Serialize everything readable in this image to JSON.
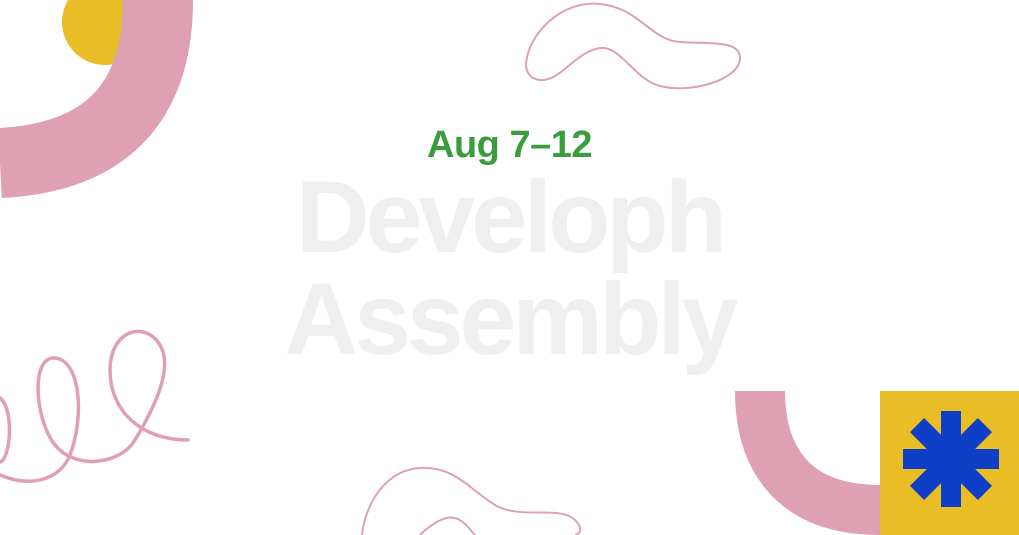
{
  "event": {
    "date_range": "Aug 7–12",
    "title_line1": "Developh",
    "title_line2": "Assembly"
  },
  "colors": {
    "background": "#ffffff",
    "date_green": "#3a9c3c",
    "title_gray": "#efefef",
    "pink": "#dfa0b3",
    "yellow": "#e8bd25",
    "blue": "#0e3fc6"
  },
  "decorations": {
    "icons": [
      "yellow-circle",
      "pink-arc",
      "pink-squiggle",
      "pink-loops",
      "pink-u-shape",
      "blue-asterisk-icon"
    ]
  }
}
